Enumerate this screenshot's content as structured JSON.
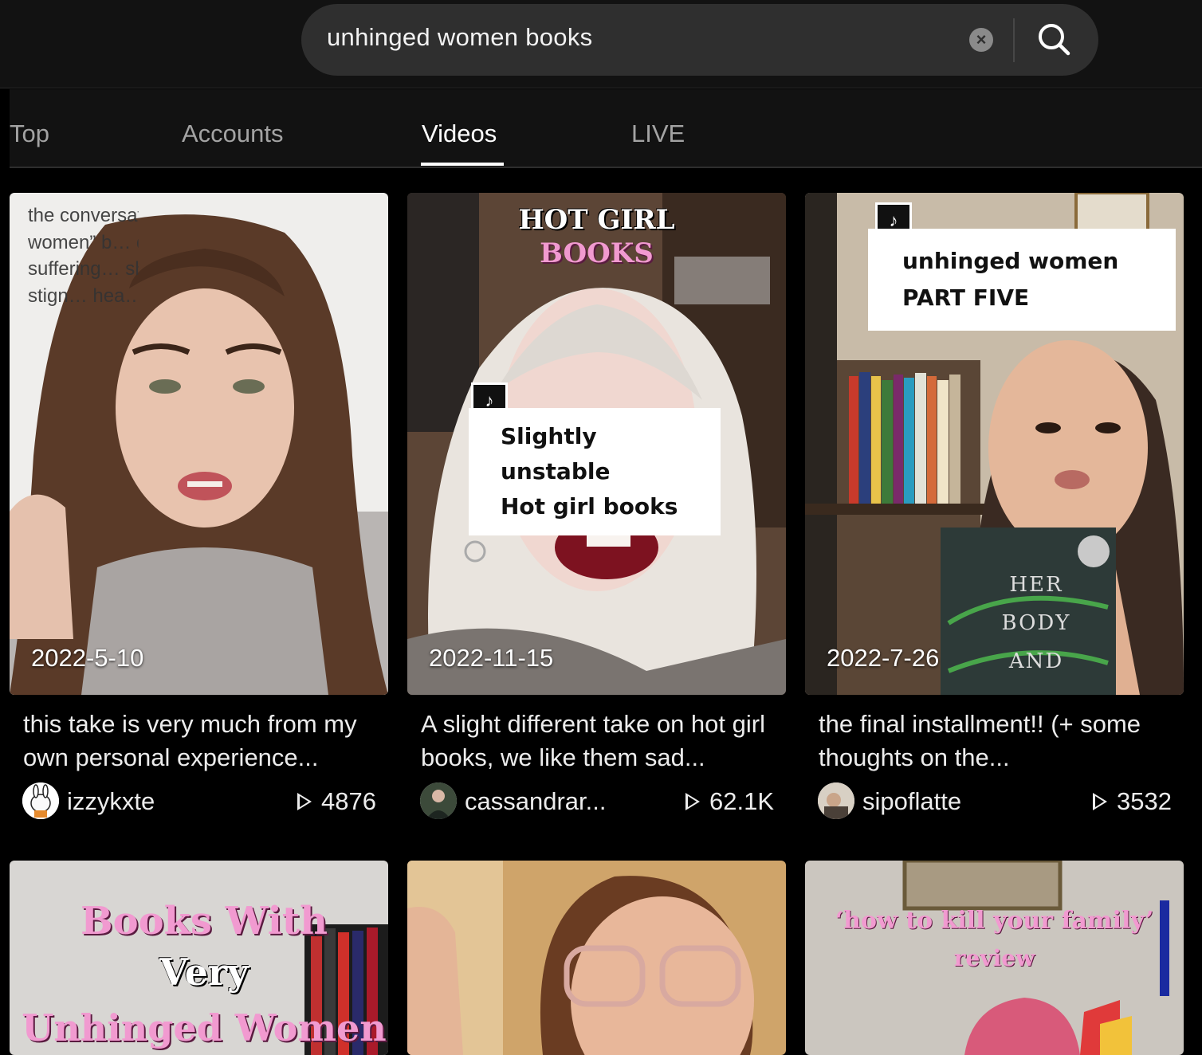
{
  "search": {
    "query": "unhinged women books"
  },
  "tabs": [
    {
      "label": "Top"
    },
    {
      "label": "Accounts"
    },
    {
      "label": "Videos"
    },
    {
      "label": "LIVE"
    }
  ],
  "active_tab": "Videos",
  "videos": [
    {
      "date": "2022-5-10",
      "overlay_text": "the conversation around “unhinged women” b… d into any book… n suffering… she’s not “u… & by using… stign… hea…",
      "description": "this take is very much from my own personal experience...",
      "author": "izzykxte",
      "views": "4876"
    },
    {
      "date": "2022-11-15",
      "overlay_title_line1": "HOT GIRL",
      "overlay_title_line2": "BOOKS",
      "overlay_caption_line1": "Slightly unstable",
      "overlay_caption_line2": "Hot girl books",
      "description": "A slight different take on hot girl books, we like them sad...",
      "author": "cassandrar...",
      "views": "62.1K"
    },
    {
      "date": "2022-7-26",
      "overlay_caption_line1": "unhinged women",
      "overlay_caption_line2": "PART FIVE",
      "book_title": "HER BODY AND",
      "description": "the final installment!! (+ some thoughts on the...",
      "author": "sipoflatte",
      "views": "3532"
    },
    {
      "overlay_line1": "Books With",
      "overlay_line2": "Very",
      "overlay_line3": "Unhinged Women"
    },
    {},
    {
      "overlay_line1": "‘how to kill your family’",
      "overlay_line2": "review"
    }
  ],
  "colors": {
    "background": "#000000",
    "search_bg": "#2f2f2f",
    "tab_inactive": "#a3a3a3",
    "pink_title": "#f19ad0"
  },
  "icons": [
    "clear-icon",
    "search-icon",
    "tiktok-logo-icon",
    "play-icon"
  ]
}
